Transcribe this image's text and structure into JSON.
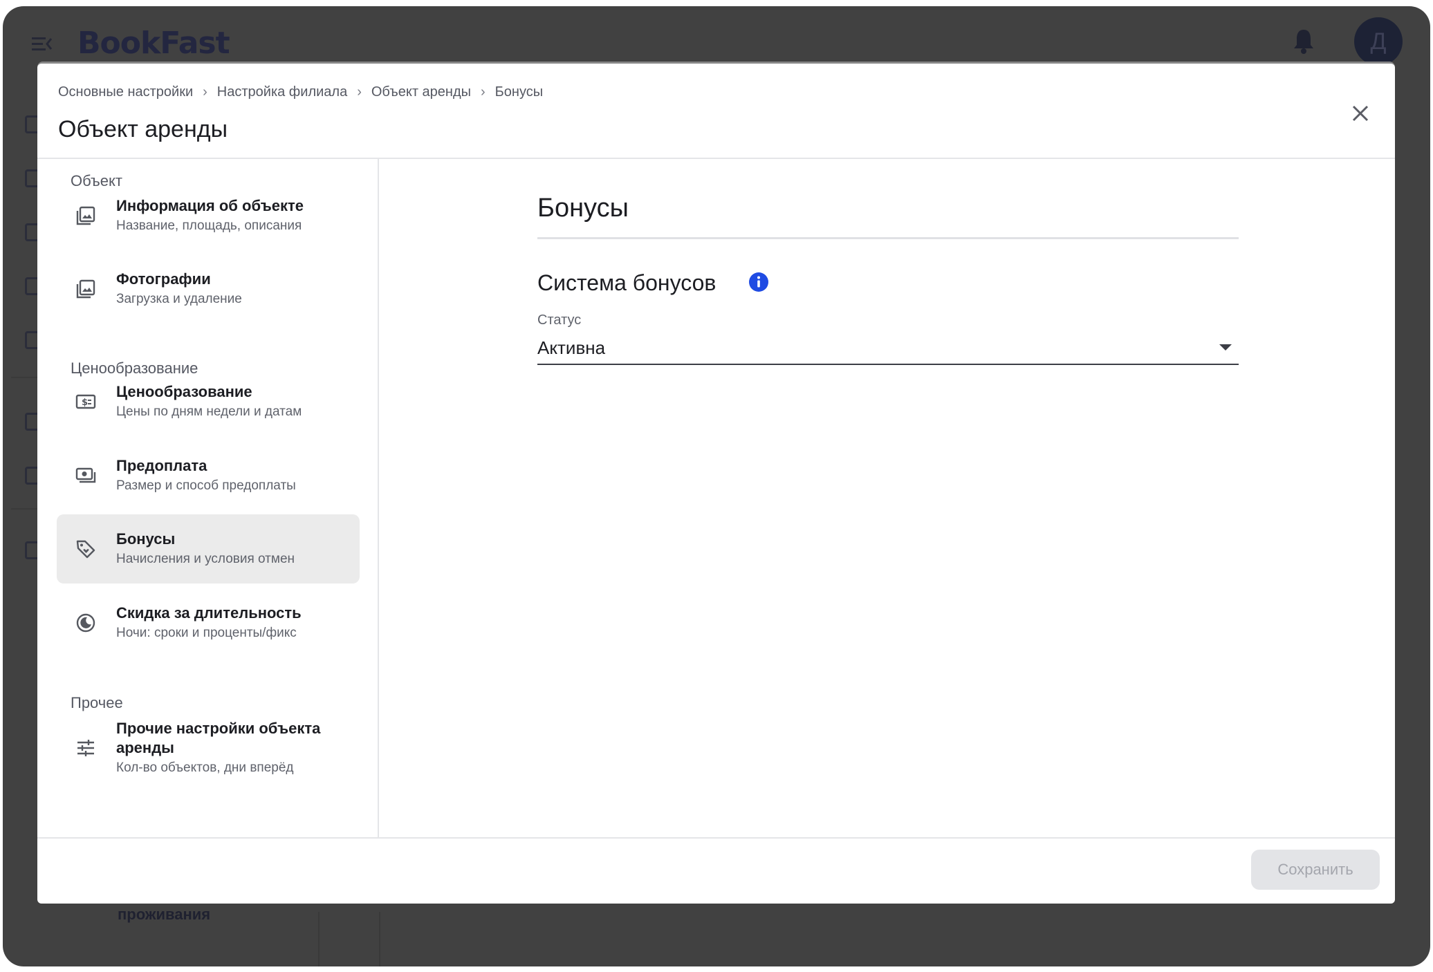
{
  "app": {
    "brand": "BookFast",
    "avatar_initial": "Д",
    "background_partial_text": "проживания"
  },
  "modal": {
    "breadcrumbs": [
      "Основные настройки",
      "Настройка филиала",
      "Объект аренды",
      "Бонусы"
    ],
    "title": "Объект аренды",
    "close_icon": "close-icon"
  },
  "nav": {
    "groups": [
      {
        "label": "Объект",
        "items": [
          {
            "title": "Информация об объекте",
            "subtitle": "Название, площадь, описания",
            "icon": "image-stack-icon",
            "active": false
          },
          {
            "title": "Фотографии",
            "subtitle": "Загрузка и удаление",
            "icon": "image-stack-icon",
            "active": false
          }
        ]
      },
      {
        "label": "Ценообразование",
        "items": [
          {
            "title": "Ценообразование",
            "subtitle": "Цены по дням недели и датам",
            "icon": "price-tag-dollar-icon",
            "active": false
          },
          {
            "title": "Предоплата",
            "subtitle": "Размер и способ предоплаты",
            "icon": "payments-icon",
            "active": false
          },
          {
            "title": "Бонусы",
            "subtitle": "Начисления и условия отмен",
            "icon": "loyalty-tag-icon",
            "active": true
          },
          {
            "title": "Скидка за длительность",
            "subtitle": "Ночи: сроки и проценты/фикс",
            "icon": "moon-circle-icon",
            "active": false
          }
        ]
      },
      {
        "label": "Прочее",
        "items": [
          {
            "title": "Прочие настройки объекта аренды",
            "subtitle": "Кол-во объектов, дни вперёд",
            "icon": "tune-sliders-icon",
            "active": false
          }
        ]
      }
    ]
  },
  "content": {
    "section_title": "Бонусы",
    "subsection_title": "Система бонусов",
    "status": {
      "label": "Статус",
      "value": "Активна"
    }
  },
  "footer": {
    "save_label": "Сохранить"
  },
  "colors": {
    "overlay": "#414141",
    "info_icon": "#1f4be3",
    "active_item_bg": "#ebebeb",
    "save_disabled_bg": "#e3e4e7",
    "save_disabled_text": "#a4a6ad"
  }
}
